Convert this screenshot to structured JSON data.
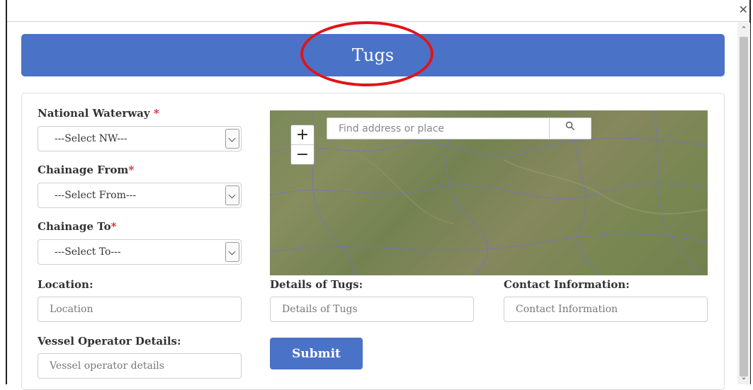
{
  "dialog": {
    "close_icon": "close-icon"
  },
  "header": {
    "title": "Tugs"
  },
  "form": {
    "national_waterway": {
      "label": "National Waterway ",
      "required": "*",
      "selected": "---Select NW---"
    },
    "chainage_from": {
      "label": "Chainage From",
      "required": "*",
      "selected": "---Select From---"
    },
    "chainage_to": {
      "label": "Chainage To",
      "required": "*",
      "selected": "---Select To---"
    },
    "location": {
      "label": "Location:",
      "placeholder": "Location"
    },
    "vessel_operator": {
      "label": "Vessel Operator Details:",
      "placeholder": "Vessel operator details"
    },
    "details_of_tugs": {
      "label": "Details of Tugs:",
      "placeholder": "Details of Tugs"
    },
    "contact_information": {
      "label": "Contact Information:",
      "placeholder": "Contact Information"
    },
    "submit_label": "Submit"
  },
  "map": {
    "search_placeholder": "Find address or place",
    "zoom_in": "+",
    "zoom_out": "−",
    "search_icon": "search-icon"
  },
  "colors": {
    "accent": "#4a73c7",
    "required": "#d9232e",
    "annotation": "#e0141a"
  }
}
